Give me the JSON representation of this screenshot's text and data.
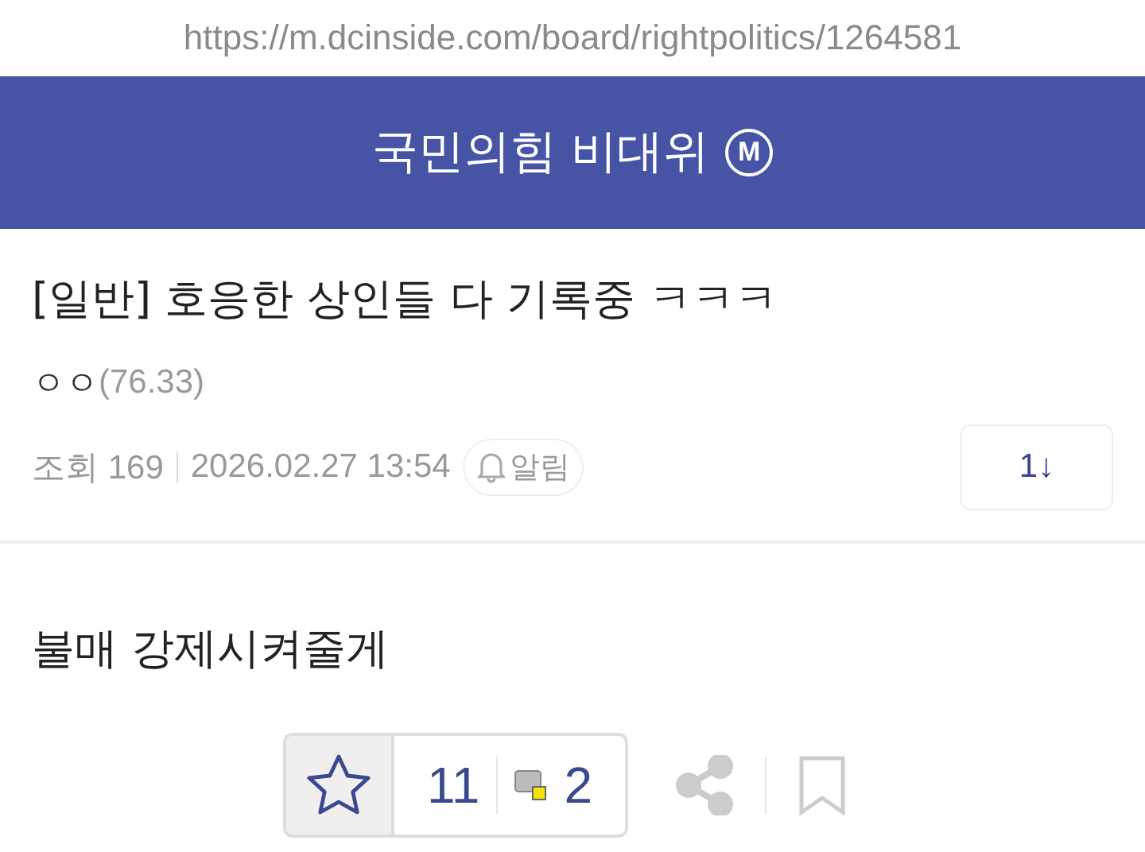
{
  "url": "https://m.dcinside.com/board/rightpolitics/1264581",
  "header": {
    "title": "국민의힘 비대위",
    "badge": "M"
  },
  "post": {
    "title": "[일반] 호응한 상인들 다 기록중 ㅋㅋㅋ",
    "author": "ㅇㅇ",
    "ip": "(76.33)",
    "views": "조회 169",
    "date": "2026.02.27 13:54",
    "alert": "알림",
    "comments": "1↓",
    "body": "불매 강제시켜줄게"
  },
  "actions": {
    "recommend": "11",
    "fixed_recommend": "2",
    "starred": false
  }
}
